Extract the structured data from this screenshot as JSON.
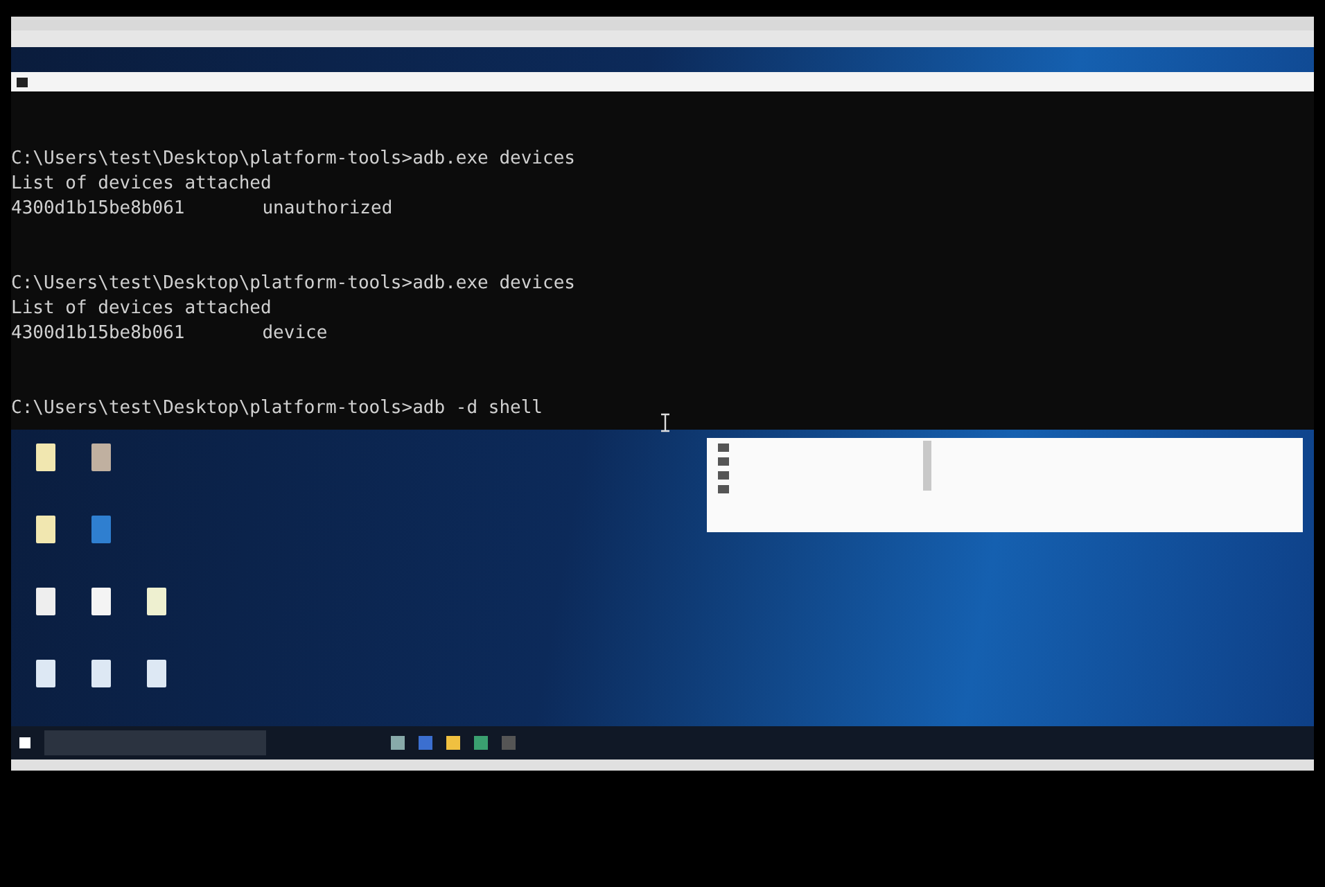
{
  "terminal": {
    "blocks": [
      {
        "command": "C:\\Users\\test\\Desktop\\platform-tools>adb.exe devices",
        "output": "List of devices attached",
        "device": {
          "serial": "4300d1b15be8b061",
          "state": "unauthorized"
        }
      },
      {
        "command": "C:\\Users\\test\\Desktop\\platform-tools>adb.exe devices",
        "output": "List of devices attached",
        "device": {
          "serial": "4300d1b15be8b061",
          "state": "device"
        }
      },
      {
        "command": "C:\\Users\\test\\Desktop\\platform-tools>adb -d shell"
      }
    ]
  }
}
